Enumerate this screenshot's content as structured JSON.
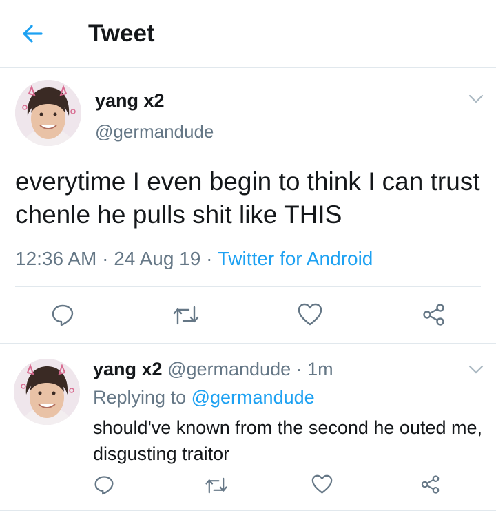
{
  "header": {
    "title": "Tweet"
  },
  "tweet": {
    "name": "yang x2",
    "handle": "@germandude",
    "text": "everytime I even begin to think I can trust chenle he pulls shit like THIS",
    "time": "12:36 AM",
    "date": "24 Aug 19",
    "source": "Twitter for Android"
  },
  "reply": {
    "name": "yang x2",
    "handle": "@germandude",
    "age": "1m",
    "replying_label": "Replying to",
    "replying_to": "@germandude",
    "text": "should've known from the second he outed me, disgusting traitor"
  },
  "colors": {
    "accent": "#1da1f2",
    "muted": "#657786",
    "text": "#14171a",
    "divider": "#e1e8ed"
  },
  "icons": [
    "back-arrow-icon",
    "chevron-down-icon",
    "reply-icon",
    "retweet-icon",
    "like-icon",
    "share-icon"
  ]
}
